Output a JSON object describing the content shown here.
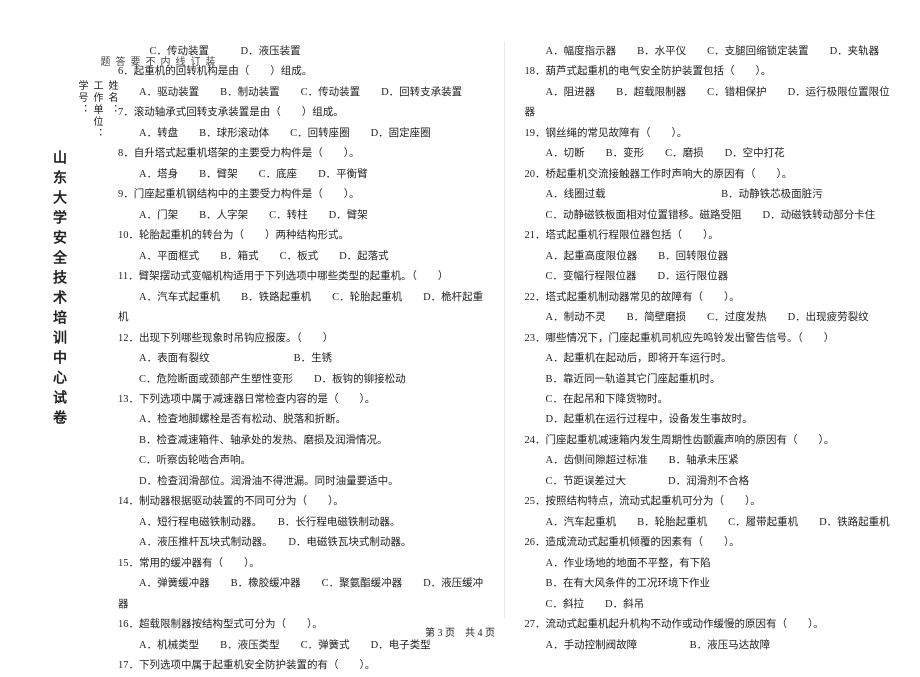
{
  "vert_title": "山东大学安全技术培训中心试卷",
  "vert_fields": {
    "name": "姓名：",
    "unit": "工作单位：",
    "id": "学号："
  },
  "vert_marks": {
    "a": "装",
    "b": "订",
    "c": "线",
    "d": "内",
    "e": "不",
    "f": "要",
    "g": "答",
    "h": "题"
  },
  "left": {
    "l01": "C．传动装置　　　D．液压装置",
    "l02": "6．起重机的回转机构是由（　　）组成。",
    "l03": "A．驱动装置　　B．制动装置　　C．传动装置　　D．回转支承装置",
    "l04": "7．滚动轴承式回转支承装置是由（　　）组成。",
    "l05": "A．转盘　　B．球形滚动体　　C．回转座圈　　D．固定座圈",
    "l06": "8．自升塔式起重机塔架的主要受力构件是（　　）。",
    "l07": "A．塔身　　B．臂架　　C．底座　　D．平衡臂",
    "l08": "9．门座起重机钢结构中的主要受力构件是（　　）。",
    "l09": "A．门架　　B．人字架　　C．转柱　　D．臂架",
    "l10": "10．轮胎起重机的转台为（　　）两种结构形式。",
    "l11": "A．平面框式　　B．箱式　　C．板式　　D．起落式",
    "l12": "11．臂架摆动式变幅机构适用于下列选项中哪些类型的起重机。（　　）",
    "l13": "A．汽车式起重机　　B．铁路起重机　　C．轮胎起重机　　D．桅杆起重机",
    "l14": "12．出现下列哪些现象时吊钩应报废。（　　）",
    "l15": "A．表面有裂纹　　　　　　　　B．生锈",
    "l16": "C．危险断面或颈部产生塑性变形　　D．板钩的铆接松动",
    "l17": "13．下列选项中属于减速器日常检查内容的是（　　）。",
    "l18": "A．检查地脚螺栓是否有松动、脱落和折断。",
    "l19": "B．检查减速箱件、轴承处的发热、磨损及润滑情况。",
    "l20": "C．听察齿轮啮合声响。",
    "l21": "D．检查润滑部位。润滑油不得泄漏。同时油量要适中。",
    "l22": "14．制动器根据驱动装置的不同可分为（　　）。",
    "l23": "A．短行程电磁铁制动器。　　B．长行程电磁铁制动器。",
    "l24": "A．液压推杆瓦块式制动器。　　D．电磁铁瓦块式制动器。",
    "l25": "15．常用的缓冲器有（　　）。",
    "l26": "A．弹簧缓冲器　　B．橡胶缓冲器　　C．聚氨酯缓冲器　　D．液压缓冲器",
    "l27": "16．超载限制器按结构型式可分为（　　）。",
    "l28": "A．机械类型　　B．液压类型　　C．弹簧式　　D．电子类型",
    "l29": "17．下列选项中属于起重机安全防护装置的有（　　）。"
  },
  "right": {
    "r01": "A．幅度指示器　　B．水平仪　　C．支腿回缩锁定装置　　D．夹轨器",
    "r02": "18．葫芦式起重机的电气安全防护装置包括（　　）。",
    "r03": "A．阻进器　　B．超载限制器　　C．错相保护　　D．运行极限位置限位器",
    "r04": "19．钢丝绳的常见故障有（　　）。",
    "r05": "A．切断　　B．变形　　C．磨损　　D．空中打花",
    "r06": "20．桥起重机交流接触器工作时声响大的原因有（　　）。",
    "r07": "A．线圈过载　　　　　　　　　　　B．动静铁芯极面脏污",
    "r08": "C．动静磁铁板面相对位置错移。磁路受阻　　D．动磁铁转动部分卡住",
    "r09": "21．塔式起重机行程限位器包括（　　）。",
    "r10": "A．起重高度限位器　　B．回转限位器",
    "r11": "C．变幅行程限位器　　D．运行限位器",
    "r12": "22．塔式起重机制动器常见的故障有（　　）。",
    "r13": "A．制动不灵　　B．简壁磨损　　C．过度发热　　D．出现疲劳裂纹",
    "r14": "23．哪些情况下，门座起重机司机应先鸣铃发出警告信号。（　　）",
    "r15": "A．起重机在起动后，即将开车运行时。",
    "r16": "B．靠近同一轨道其它门座起重机时。",
    "r17": "C．在起吊和下降货物时。",
    "r18": "D．起重机在运行过程中，设备发生事故时。",
    "r19": "24．门座起重机减速箱内发生周期性齿颤震声响的原因有（　　）。",
    "r20": "A．齿侧间隙超过标准　　B．轴承未压紧",
    "r21": "C．节距误差过大　　　　D．润滑剂不合格",
    "r22": "25．按照结构特点，流动式起重机可分为（　　）。",
    "r23": "A．汽车起重机　　B．轮胎起重机　　C．履带起重机　　D．铁路起重机",
    "r24": "26．造成流动式起重机倾覆的因素有（　　）。",
    "r25": "A．作业场地的地面不平整，有下陷",
    "r26": "B．在有大风条件的工况环境下作业",
    "r27": "C．斜拉　　D．斜吊",
    "r28": "27．流动式起重机起升机构不动作或动作缓慢的原因有（　　）。",
    "r29": "A．手动控制阀故障　　　　　B．液压马达故障"
  },
  "footer": "第 3 页　共 4 页"
}
